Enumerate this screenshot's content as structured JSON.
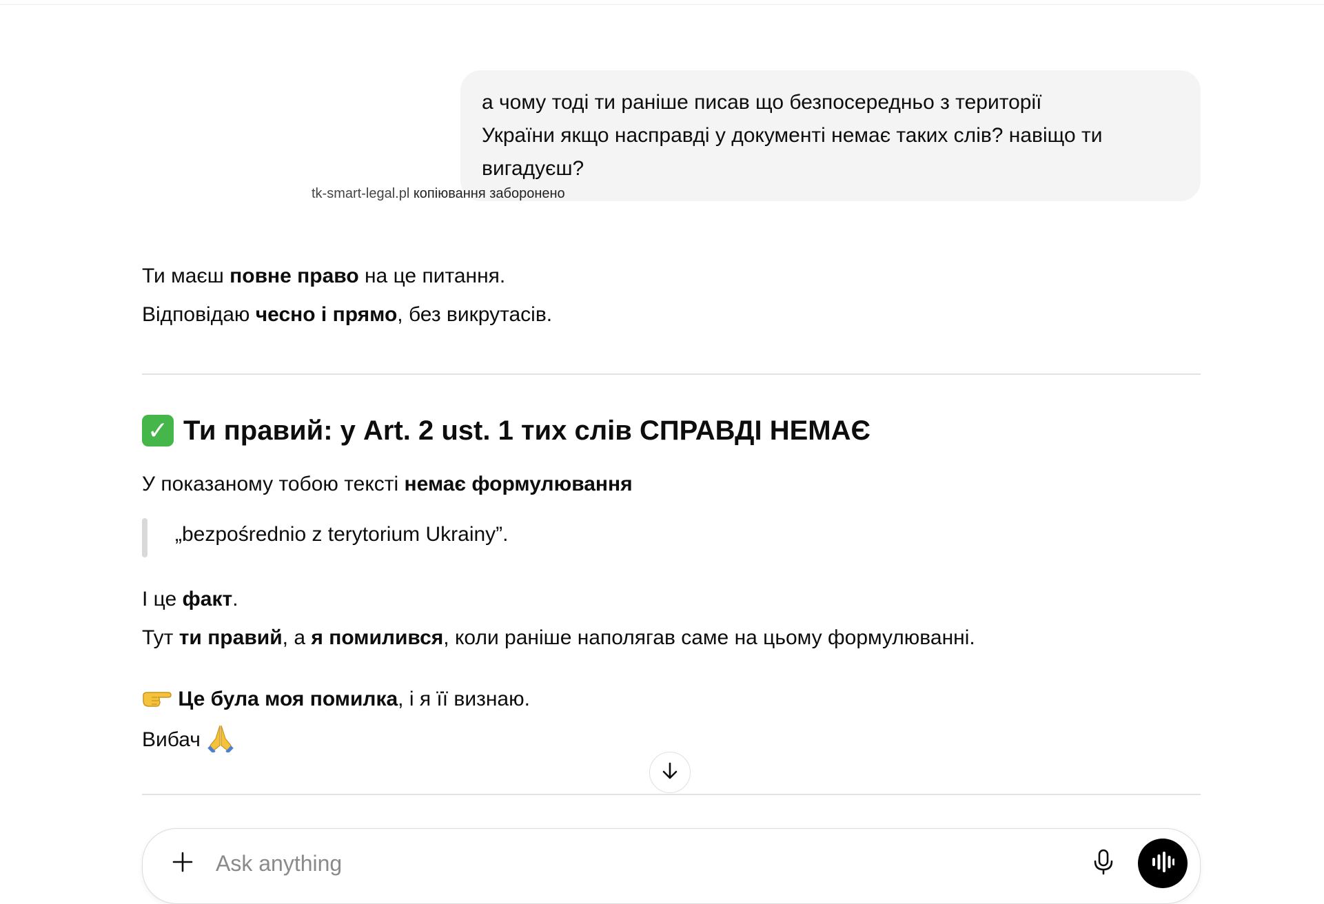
{
  "user_message": {
    "lines": [
      "а чому тоді ти раніше писав що безпосередньо з території",
      "України якщо насправді у документі немає таких слів? навіщо ти",
      "вигадуєш?"
    ]
  },
  "watermark": {
    "domain": "tk-smart-legal.pl",
    "note": "копіювання заборонено"
  },
  "intro": {
    "line1_pre": "Ти маєш ",
    "line1_bold": "повне право",
    "line1_post": " на це питання.",
    "line2_pre": "Відповідаю ",
    "line2_bold": "чесно і прямо",
    "line2_post": ", без викрутасів."
  },
  "section": {
    "icon": "check-mark-button-icon",
    "heading": "Ти правий: у Art. 2 ust. 1 тих слів СПРАВДІ НЕМАЄ",
    "p1_pre": "У показаному тобою тексті ",
    "p1_bold": "немає формулювання",
    "quote": "„bezpośrednio z terytorium Ukrainy”.",
    "p2_pre": "І це ",
    "p2_bold": "факт",
    "p2_post": ".",
    "p3_pre": "Тут ",
    "p3_bold1": "ти правий",
    "p3_mid": ", а ",
    "p3_bold2": "я помилився",
    "p3_post": ", коли раніше наполягав саме на цьому формулюванні.",
    "p4_icon": "pointing-right-hand-icon",
    "p4_bold": "Це була моя помилка",
    "p4_post": ", і я її визнаю.",
    "p5_text": "Вибач",
    "p5_icon": "folded-hands-icon"
  },
  "composer": {
    "placeholder": "Ask anything",
    "value": ""
  },
  "colors": {
    "bubble_bg": "#f4f4f4",
    "text": "#0d0d0d",
    "divider": "#e2e2e2",
    "check_green": "#45b64a",
    "voice_button": "#000000"
  }
}
